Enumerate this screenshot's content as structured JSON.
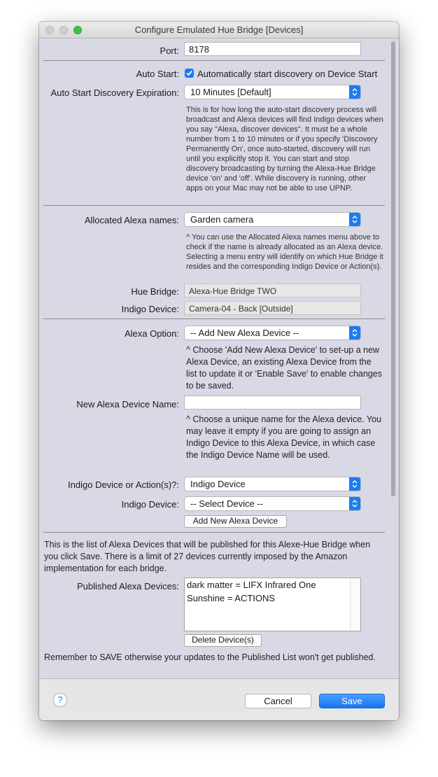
{
  "window": {
    "title": "Configure Emulated Hue Bridge [Devices]"
  },
  "port": {
    "label": "Port:",
    "value": "8178"
  },
  "auto_start": {
    "label": "Auto Start:",
    "checked": true,
    "text": "Automatically start discovery on Device Start"
  },
  "expiration": {
    "label": "Auto Start Discovery Expiration:",
    "selected": "10 Minutes [Default]",
    "help": "This is for how long the auto-start discovery process will broadcast and Alexa devices will find Indigo devices when you say \"Alexa, discover devices\". It must be a whole number from 1 to 10 minutes or if you specify 'Discovery Permanently On', once auto-started, discovery will run until you explicitly stop it. You can start and stop discovery broadcasting by turning the Alexa-Hue Bridge device 'on' and 'off'. While discovery is running, other apps on your Mac may not be able to use UPNP."
  },
  "allocated": {
    "label": "Allocated Alexa names:",
    "selected": "Garden camera",
    "help": "^ You can use the Allocated Alexa names menu above to check if the name is already allocated as an Alexa device. Selecting a menu entry will identify on which Hue Bridge it resides and the corresponding Indigo Device or Action(s).",
    "hue_bridge_label": "Hue Bridge:",
    "hue_bridge_value": "Alexa-Hue Bridge TWO",
    "indigo_device_label": "Indigo Device:",
    "indigo_device_value": "Camera-04 - Back [Outside]"
  },
  "alexa_option": {
    "label": "Alexa Option:",
    "selected": "-- Add New Alexa Device --",
    "help": "^ Choose 'Add New Alexa Device' to set-up a new Alexa Device, an existing Alexa Device from the list to update it or 'Enable Save' to enable changes to be saved."
  },
  "new_name": {
    "label": "New Alexa Device Name:",
    "value": "",
    "help": "^ Choose a unique name for the Alexa device. You may leave it empty if you are going to assign an Indigo Device to this Alexa Device, in which case the Indigo Device Name will be used."
  },
  "device_or_action": {
    "label": "Indigo Device or Action(s)?:",
    "selected": "Indigo Device"
  },
  "indigo_device": {
    "label": "Indigo Device:",
    "selected": "-- Select Device --"
  },
  "add_button": "Add New Alexa Device",
  "published": {
    "intro": "This is the list of Alexa Devices that will be published for this Alexe-Hue Bridge when you click Save. There is a limit of 27 devices currently imposed by the Amazon implementation for each bridge.",
    "label": "Published Alexa Devices:",
    "items": [
      "dark matter = LIFX Infrared One",
      "Sunshine = ACTIONS"
    ],
    "delete_button": "Delete Device(s)",
    "reminder": "Remember to SAVE otherwise your updates to the Published List won't get published."
  },
  "footer": {
    "help_symbol": "?",
    "cancel": "Cancel",
    "save": "Save"
  },
  "colors": {
    "accent": "#1a7cf5",
    "panel": "#d9d9e6",
    "close_zoom": "#35c649"
  }
}
